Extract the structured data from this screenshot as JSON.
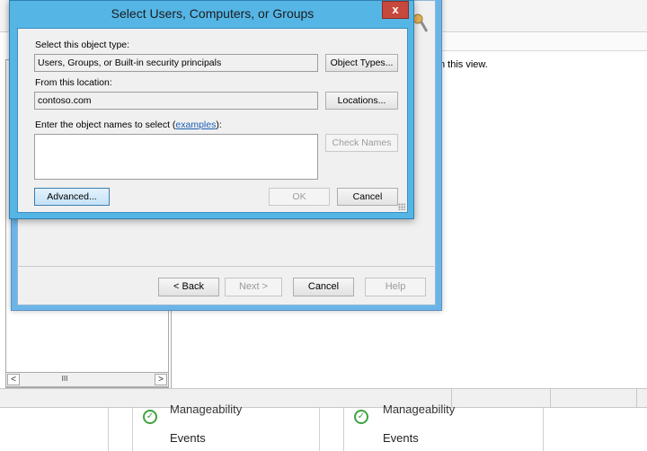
{
  "background": {
    "empty_view_message": "n this view.",
    "scroll_left": "<",
    "scroll_right": ">",
    "scroll_thumb": "III",
    "tiles": [
      {
        "status": "Manageability",
        "link": "Events"
      },
      {
        "status": "Manageability",
        "link": "Events"
      }
    ]
  },
  "wizard": {
    "back_label": "< Back",
    "next_label": "Next >",
    "cancel_label": "Cancel",
    "help_label": "Help"
  },
  "select_dialog": {
    "title": "Select Users, Computers, or Groups",
    "close_glyph": "x",
    "object_type_label": "Select this object type:",
    "object_type_value": "Users, Groups, or Built-in security principals",
    "object_types_button": "Object Types...",
    "location_label": "From this location:",
    "location_value": "contoso.com",
    "locations_button": "Locations...",
    "names_label_prefix": "Enter the object names to select (",
    "names_label_link": "examples",
    "names_label_suffix": "):",
    "names_value": "",
    "check_names_button": "Check Names",
    "advanced_button": "Advanced...",
    "ok_button": "OK",
    "cancel_button": "Cancel"
  },
  "colors": {
    "title_bar": "#55b6e6",
    "close_button": "#c7483c",
    "link": "#1a5fb4",
    "check_green": "#3fa33f"
  }
}
